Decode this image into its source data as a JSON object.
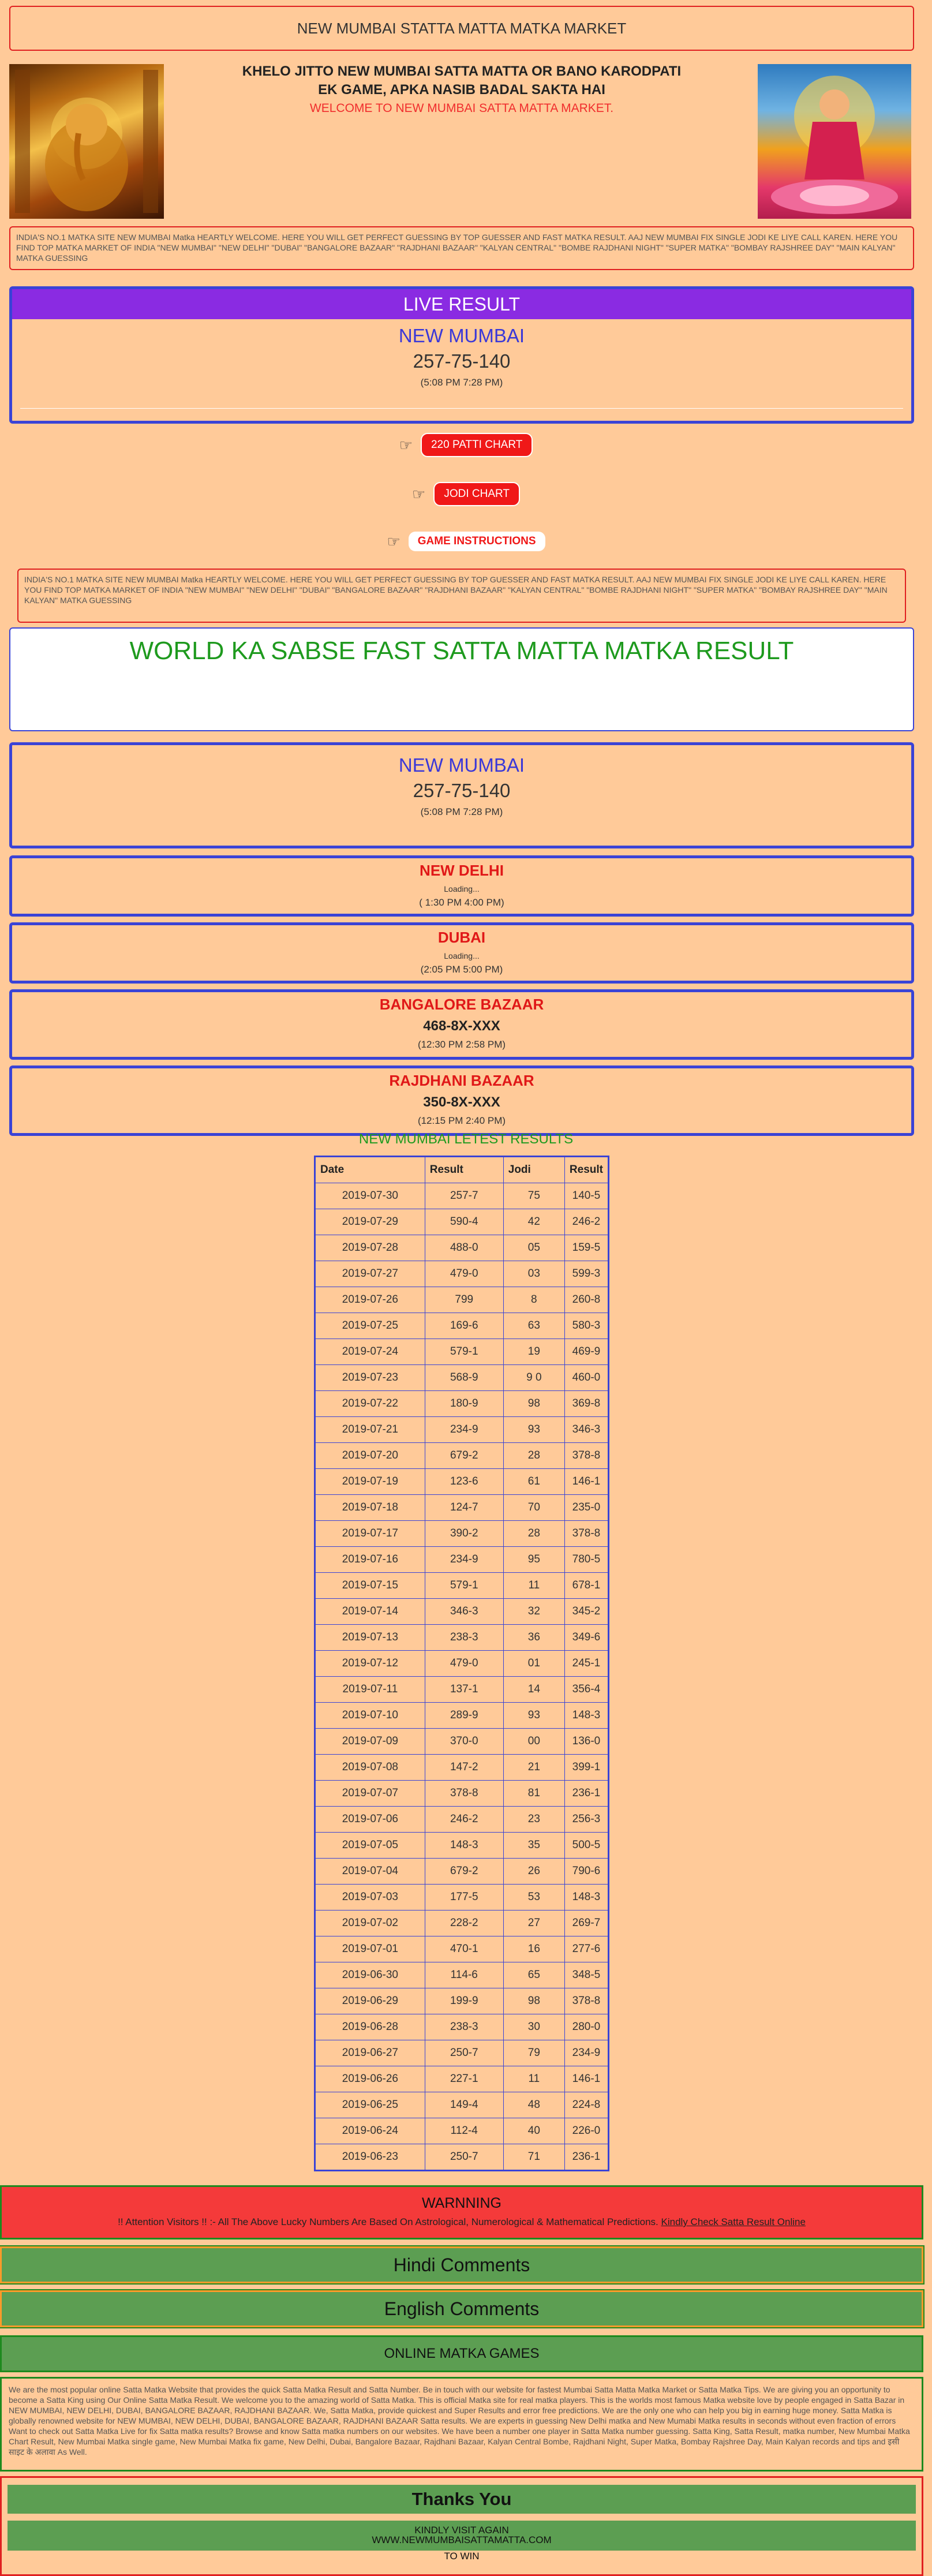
{
  "header": {
    "title": "NEW MUMBAI STATTA MATTA MATKA MARKET"
  },
  "hero": {
    "slogan_line1": "KHELO JITTO NEW MUMBAI SATTA MATTA OR BANO KARODPATI",
    "slogan_line2": "EK GAME, APKA NASIB BADAL SAKTA HAI",
    "welcome": "WELCOME TO NEW MUMBAI SATTA MATTA MARKET."
  },
  "intro": {
    "text": "INDIA'S NO.1 MATKA SITE NEW MUMBAI Matka HEARTLY WELCOME. HERE YOU WILL GET PERFECT GUESSING BY TOP GUESSER AND FAST MATKA RESULT. AAJ NEW MUMBAI FIX SINGLE JODI KE LIYE CALL KAREN. HERE YOU FIND TOP MATKA MARKET OF INDIA \"NEW MUMBAI\" \"NEW DELHI\" \"DUBAI\" \"BANGALORE BAZAAR\" \"RAJDHANI BAZAAR\" \"KALYAN CENTRAL\" \"BOMBE RAJDHANI NIGHT\" \"SUPER MATKA\" \"BOMBAY RAJSHREE DAY\" \"MAIN KALYAN\" MATKA GUESSING"
  },
  "live": {
    "heading": "LIVE RESULT",
    "market": "NEW MUMBAI",
    "result": "257-75-140",
    "time": "(5:08 PM  7:28 PM)"
  },
  "buttons": {
    "patti_chart": "220 PATTI CHART",
    "jodi_chart": "JODI CHART",
    "game_instructions": "GAME INSTRUCTIONS",
    "hand_icon": "pointing-hand-icon"
  },
  "fast": {
    "text": "WORLD KA SABSE FAST SATTA MATTA MATKA RESULT"
  },
  "markets": [
    {
      "name": "NEW MUMBAI",
      "result": "257-75-140",
      "time": "(5:08 PM  7:28 PM)"
    },
    {
      "name": "NEW DELHI",
      "status": "Loading...",
      "time": "( 1:30 PM  4:00 PM)"
    },
    {
      "name": "DUBAI",
      "status": "Loading...",
      "time": "(2:05 PM  5:00 PM)"
    },
    {
      "name": "BANGALORE BAZAAR",
      "result": "468-8X-XXX",
      "time": "(12:30 PM  2:58 PM)"
    },
    {
      "name": "RAJDHANI BAZAAR",
      "result": "350-8X-XXX",
      "time": "(12:15 PM  2:40 PM)"
    }
  ],
  "results_table": {
    "title": "NEW MUMBAI LETEST RESULTS",
    "headers": [
      "Date",
      "Result",
      "Jodi",
      "Result"
    ],
    "rows": [
      [
        "2019-07-30",
        "257-7",
        "75",
        "140-5"
      ],
      [
        "2019-07-29",
        "590-4",
        "42",
        "246-2"
      ],
      [
        "2019-07-28",
        "488-0",
        "05",
        "159-5"
      ],
      [
        "2019-07-27",
        "479-0",
        "03",
        "599-3"
      ],
      [
        "2019-07-26",
        "799",
        "8",
        "260-8"
      ],
      [
        "2019-07-25",
        "169-6",
        "63",
        "580-3"
      ],
      [
        "2019-07-24",
        "579-1",
        "19",
        "469-9"
      ],
      [
        "2019-07-23",
        "568-9",
        "9 0",
        "460-0"
      ],
      [
        "2019-07-22",
        "180-9",
        "98",
        "369-8"
      ],
      [
        "2019-07-21",
        "234-9",
        "93",
        "346-3"
      ],
      [
        "2019-07-20",
        "679-2",
        "28",
        "378-8"
      ],
      [
        "2019-07-19",
        "123-6",
        "61",
        "146-1"
      ],
      [
        "2019-07-18",
        "124-7",
        "70",
        "235-0"
      ],
      [
        "2019-07-17",
        "390-2",
        "28",
        "378-8"
      ],
      [
        "2019-07-16",
        "234-9",
        "95",
        "780-5"
      ],
      [
        "2019-07-15",
        "579-1",
        "11",
        "678-1"
      ],
      [
        "2019-07-14",
        "346-3",
        "32",
        "345-2"
      ],
      [
        "2019-07-13",
        "238-3",
        "36",
        "349-6"
      ],
      [
        "2019-07-12",
        "479-0",
        "01",
        "245-1"
      ],
      [
        "2019-07-11",
        "137-1",
        "14",
        "356-4"
      ],
      [
        "2019-07-10",
        "289-9",
        "93",
        "148-3"
      ],
      [
        "2019-07-09",
        "370-0",
        "00",
        "136-0"
      ],
      [
        "2019-07-08",
        "147-2",
        "21",
        "399-1"
      ],
      [
        "2019-07-07",
        "378-8",
        "81",
        "236-1"
      ],
      [
        "2019-07-06",
        "246-2",
        "23",
        "256-3"
      ],
      [
        "2019-07-05",
        "148-3",
        "35",
        "500-5"
      ],
      [
        "2019-07-04",
        "679-2",
        "26",
        "790-6"
      ],
      [
        "2019-07-03",
        "177-5",
        "53",
        "148-3"
      ],
      [
        "2019-07-02",
        "228-2",
        "27",
        "269-7"
      ],
      [
        "2019-07-01",
        "470-1",
        "16",
        "277-6"
      ],
      [
        "2019-06-30",
        "114-6",
        "65",
        "348-5"
      ],
      [
        "2019-06-29",
        "199-9",
        "98",
        "378-8"
      ],
      [
        "2019-06-28",
        "238-3",
        "30",
        "280-0"
      ],
      [
        "2019-06-27",
        "250-7",
        "79",
        "234-9"
      ],
      [
        "2019-06-26",
        "227-1",
        "11",
        "146-1"
      ],
      [
        "2019-06-25",
        "149-4",
        "48",
        "224-8"
      ],
      [
        "2019-06-24",
        "112-4",
        "40",
        "226-0"
      ],
      [
        "2019-06-23",
        "250-7",
        "71",
        "236-1"
      ]
    ]
  },
  "warning": {
    "heading": "WARNNING",
    "text": "!! Attention Visitors !! :- All The Above Lucky Numbers Are Based On Astrological, Numerological & Mathematical Predictions.",
    "link": "Kindly Check Satta Result Online"
  },
  "sections": {
    "hindi_comments": "Hindi Comments",
    "english_comments": "English Comments",
    "online_games": "ONLINE MATKA GAMES"
  },
  "about": {
    "text": "We are the most popular online Satta Matka Website that provides the quick Satta Matka Result and Satta Number. Be in touch with our website for fastest Mumbai Satta Matta Matka Market or Satta Matka Tips. We are giving you an opportunity to become a Satta King using Our Online Satta Matka Result. We welcome you to the amazing world of Satta Matka. This is official Matka site for real matka players. This is the worlds most famous Matka website love by people engaged in Satta Bazar in NEW MUMBAI, NEW DELHI, DUBAI, BANGALORE BAZAAR, RAJDHANI BAZAAR. We, Satta Matka, provide quickest and Super Results and error free predictions. We are the only one who can help you big in earning huge money. Satta Matka is globally renowned website for NEW MUMBAI, NEW DELHI, DUBAI, BANGALORE BAZAAR, RAJDHANI BAZAAR Satta results. We are experts in guessing New Delhi matka and New Mumabi Matka results in seconds without even fraction of errors Want to check out Satta Matka Live for fix Satta matka results? Browse and know Satta matka numbers on our websites. We have been a number one player in Satta Matka number guessing. Satta King, Satta Result, matka number, New Mumbai Matka Chart Result, New Mumbai Matka single game, New Mumbai Matka fix game, New Delhi, Dubai, Bangalore Bazaar, Rajdhani Bazaar, Kalyan Central Bombe, Rajdhani Night, Super Matka, Bombay Rajshree Day, Main Kalyan records and tips and इसी साइट के अलावा As Well."
  },
  "footer": {
    "thanks": "Thanks You",
    "visit_line1": "KINDLY VISIT AGAIN",
    "visit_line2": "WWW.NEWMUMBAISATTAMATTA.COM",
    "to_win": "TO WIN"
  }
}
